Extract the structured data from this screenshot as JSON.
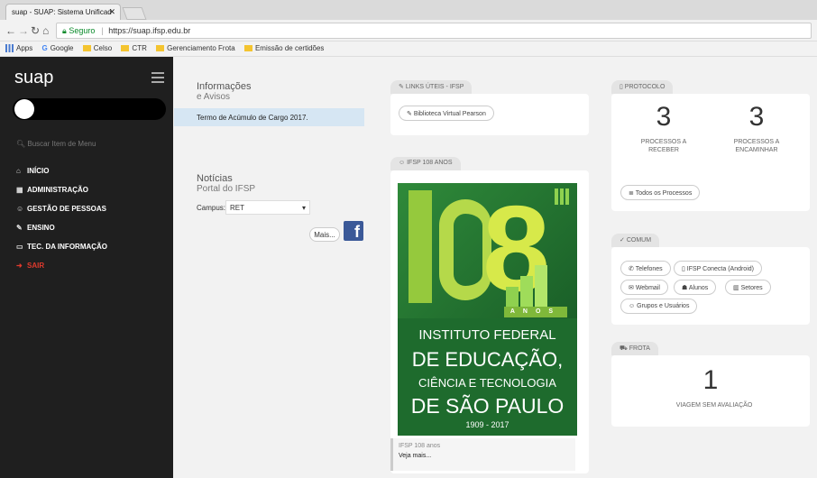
{
  "browser": {
    "tab_title": "suap - SUAP: Sistema Unificad",
    "tab_close": "✕",
    "secure_label": "Seguro",
    "url": "https://suap.ifsp.edu.br",
    "bookmarks": [
      "Apps",
      "Google",
      "Celso",
      "CTR",
      "Gerenciamento Frota",
      "Emissão de certidões"
    ]
  },
  "sidebar": {
    "logo": "suap",
    "search_placeholder": "Buscar Item de Menu",
    "items": [
      {
        "icon": "home-icon",
        "glyph": "⌂",
        "label": "INÍCIO"
      },
      {
        "icon": "admin-icon",
        "glyph": "▦",
        "label": "ADMINISTRAÇÃO"
      },
      {
        "icon": "people-icon",
        "glyph": "☺",
        "label": "GESTÃO DE PESSOAS"
      },
      {
        "icon": "pencil-icon",
        "glyph": "✎",
        "label": "ENSINO"
      },
      {
        "icon": "laptop-icon",
        "glyph": "▭",
        "label": "TEC. DA INFORMAÇÃO"
      },
      {
        "icon": "exit-icon",
        "glyph": "➜",
        "label": "SAIR"
      }
    ]
  },
  "info": {
    "title": "Informações",
    "subtitle": "e Avisos",
    "item": "Termo de Acúmulo de Cargo 2017."
  },
  "news": {
    "title": "Notícias",
    "subtitle": "Portal do IFSP",
    "campus_label": "Campus:",
    "campus_value": "RET",
    "more_label": "Mais..."
  },
  "links": {
    "chip": "LINKS ÚTEIS - IFSP",
    "item": "Biblioteca Virtual Pearson"
  },
  "anniversary": {
    "chip": "IFSP 108 ANOS",
    "poster_anos": "ANOS",
    "poster_line1": "INSTITUTO FEDERAL",
    "poster_line2": "DE EDUCAÇÃO,",
    "poster_line3": "CIÊNCIA E TECNOLOGIA",
    "poster_line4": "DE SÃO PAULO",
    "poster_years": "1909 - 2017",
    "caption": "IFSP 108 anos",
    "link": "Veja mais..."
  },
  "protocolo": {
    "chip": "PROTOCOLO",
    "receber_count": "3",
    "receber_label": "PROCESSOS A RECEBER",
    "encaminhar_count": "3",
    "encaminhar_label": "PROCESSOS A ENCAMINHAR",
    "all_button": "Todos os Processos"
  },
  "comum": {
    "chip": "COMUM",
    "buttons": [
      "Telefones",
      "IFSP Conecta (Android)",
      "Webmail",
      "Alunos",
      "Setores",
      "Grupos e Usuários"
    ]
  },
  "frota": {
    "chip": "FROTA",
    "count": "1",
    "label": "VIAGEM SEM AVALIAÇÃO"
  },
  "colors": {
    "sidebar_bg": "#1f1f1f",
    "exit_red": "#e03a2d",
    "facebook_blue": "#3b5998",
    "poster_green": "#1e6b2d"
  }
}
